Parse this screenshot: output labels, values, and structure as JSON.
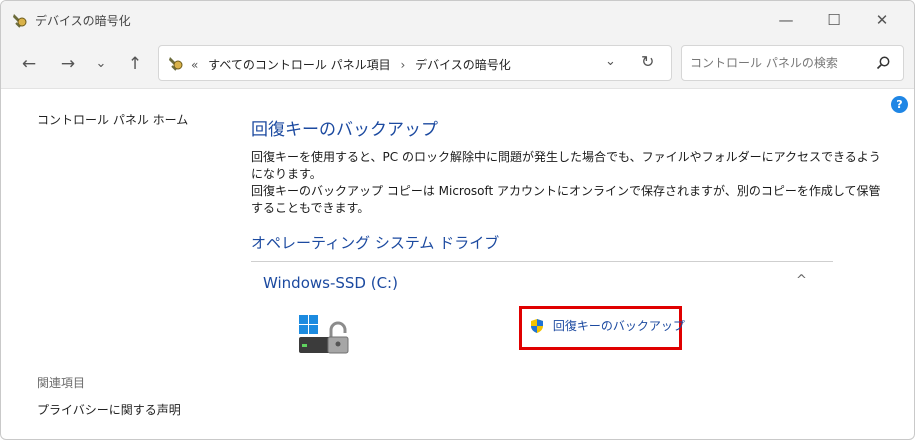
{
  "window": {
    "title": "デバイスの暗号化",
    "controls": {
      "minimize": "—",
      "maximize": "☐",
      "close": "✕"
    }
  },
  "nav": {
    "back": "←",
    "forward": "→",
    "recent": "⌄",
    "up": "↑",
    "breadcrumb": [
      "«",
      "すべてのコントロール パネル項目",
      "›",
      "デバイスの暗号化"
    ],
    "dropdown": "⌄",
    "refresh": "↻",
    "search_placeholder": "コントロール パネルの検索"
  },
  "help": {
    "label": "?"
  },
  "left_pane": {
    "home": "コントロール パネル ホーム",
    "related_heading": "関連項目",
    "privacy_link": "プライバシーに関する声明"
  },
  "main": {
    "title": "回復キーのバックアップ",
    "desc_line1": "回復キーを使用すると、PC のロック解除中に問題が発生した場合でも、ファイルやフォルダーにアクセスできるようになります。",
    "desc_line2": "回復キーのバックアップ コピーは Microsoft アカウントにオンラインで保存されますが、別のコピーを作成して保管することもできます。",
    "section_title": "オペレーティング システム ドライブ",
    "drive_name": "Windows-SSD (C:)",
    "collapse": "^",
    "action_label": "回復キーのバックアップ"
  },
  "icons": {
    "app": "security-key-icon",
    "search": "search-icon",
    "drive": "encrypted-drive-icon",
    "uac": "uac-shield-icon"
  },
  "colors": {
    "link": "#1c4aa0",
    "highlight": "#e00000",
    "help": "#1f86e5"
  }
}
